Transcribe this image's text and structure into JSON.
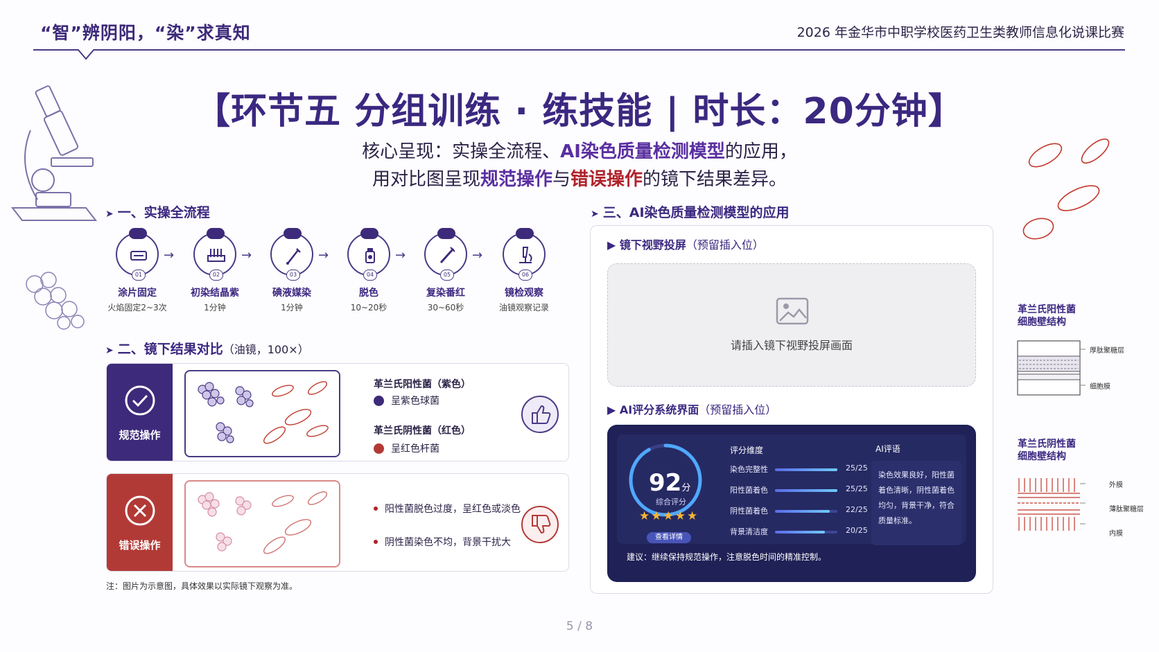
{
  "header": {
    "left": "“智”辨阴阳，“染”求真知",
    "right": "2026 年金华市中职学校医药卫生类教师信息化说课比赛"
  },
  "title": "【环节五  分组训练 · 练技能 | 时长：20分钟】",
  "subtitle": {
    "line1_a": "核心呈现：实操全流程、",
    "line1_b": "AI染色质量检测模型",
    "line1_c": "的应用，",
    "line2_a": "用对比图呈现",
    "line2_b": "规范操作",
    "line2_c": "与",
    "line2_d": "错误操作",
    "line2_e": "的镜下结果差异。"
  },
  "section1": {
    "title": "一、实操全流程",
    "steps": [
      {
        "num": "01",
        "label": "涂片固定",
        "sub": "火焰固定2~3次",
        "icon": "slide-icon"
      },
      {
        "num": "02",
        "label": "初染结晶紫",
        "sub": "1分钟",
        "icon": "reagent-rack-icon"
      },
      {
        "num": "03",
        "label": "碘液媒染",
        "sub": "1分钟",
        "icon": "dropper-icon"
      },
      {
        "num": "04",
        "label": "脱色",
        "sub": "10~20秒",
        "icon": "bottle-icon"
      },
      {
        "num": "05",
        "label": "复染番红",
        "sub": "30~60秒",
        "icon": "pipette-icon"
      },
      {
        "num": "06",
        "label": "镜检观察",
        "sub": "油镜观察记录",
        "icon": "microscope-icon"
      }
    ]
  },
  "section2": {
    "title": "二、镜下结果对比",
    "note": "（油镜，100×）",
    "correct": {
      "label": "规范操作",
      "pos_title": "革兰氏阳性菌（紫色）",
      "pos_desc": "呈紫色球菌",
      "neg_title": "革兰氏阴性菌（红色）",
      "neg_desc": "呈红色杆菌"
    },
    "wrong": {
      "label": "错误操作",
      "err1": "阳性菌脱色过度，呈红色或淡色",
      "err2": "阴性菌染色不均，背景干扰大"
    },
    "footnote": "注：图片为示意图，具体效果以实际镜下观察为准。"
  },
  "section3": {
    "title": "三、AI染色质量检测模型的应用",
    "screen_title": "镜下视野投屏",
    "screen_note": "（预留插入位）",
    "screen_placeholder": "请插入镜下视野投屏画面",
    "ai_title": "AI评分系统界面",
    "ai_note": "（预留插入位）",
    "ai": {
      "score": "92",
      "score_unit": "分",
      "score_label": "综合评分",
      "stars": "★★★★★",
      "detail_button": "查看详情",
      "dims_title": "评分维度",
      "dims": [
        {
          "name": "染色完整性",
          "value": "25/25",
          "fill": 1.0
        },
        {
          "name": "阳性菌着色",
          "value": "25/25",
          "fill": 1.0
        },
        {
          "name": "阴性菌着色",
          "value": "22/25",
          "fill": 0.88
        },
        {
          "name": "背景清洁度",
          "value": "20/25",
          "fill": 0.8
        }
      ],
      "comment_title": "AI评语",
      "comment": "染色效果良好，阳性菌着色清晰，阴性菌着色均匀，背景干净，符合质量标准。",
      "advice": "建议：继续保持规范操作，注意脱色时间的精准控制。"
    }
  },
  "diagrams": {
    "pos": {
      "title_l1": "革兰氏阳性菌",
      "title_l2": "细胞壁结构",
      "lbl1": "厚肽聚糖层",
      "lbl2": "细胞膜"
    },
    "neg": {
      "title_l1": "革兰氏阴性菌",
      "title_l2": "细胞壁结构",
      "lbl1": "外膜",
      "lbl2": "薄肽聚糖层",
      "lbl3": "内膜"
    }
  },
  "page": "5 / 8",
  "colors": {
    "primary": "#3b2880",
    "correct": "#3d2a7a",
    "wrong": "#b23a36",
    "ai_bg": "#1f2157"
  }
}
